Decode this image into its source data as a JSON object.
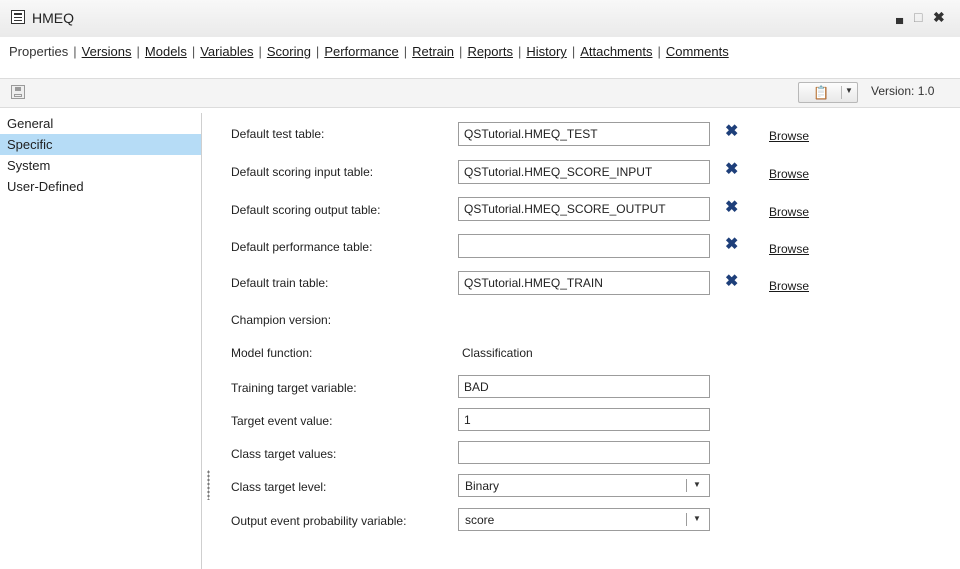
{
  "window": {
    "title": "HMEQ",
    "minimize": "▄",
    "restore": "□",
    "close": "✖"
  },
  "nav": {
    "items": [
      "Properties",
      "Versions",
      "Models",
      "Variables",
      "Scoring",
      "Performance",
      "Retrain",
      "Reports",
      "History",
      "Attachments",
      "Comments"
    ],
    "separator": "|"
  },
  "toolbar": {
    "version_label": "Version:",
    "version_value": "1.0"
  },
  "left_pane": {
    "items": [
      "General",
      "Specific",
      "System",
      "User-Defined"
    ],
    "selected": "Specific"
  },
  "form": {
    "browse_label": "Browse",
    "clear_icon": "✖",
    "rows": {
      "test_table": {
        "label": "Default test table:",
        "value": "QSTutorial.HMEQ_TEST"
      },
      "scoring_input": {
        "label": "Default scoring input table:",
        "value": "QSTutorial.HMEQ_SCORE_INPUT"
      },
      "scoring_output": {
        "label": "Default scoring output table:",
        "value": "QSTutorial.HMEQ_SCORE_OUTPUT"
      },
      "performance_table": {
        "label": "Default performance table:",
        "value": ""
      },
      "train_table": {
        "label": "Default train table:",
        "value": "QSTutorial.HMEQ_TRAIN"
      },
      "champion_version": {
        "label": "Champion version:",
        "value": ""
      },
      "model_function": {
        "label": "Model function:",
        "value": "Classification"
      },
      "training_target": {
        "label": "Training target variable:",
        "value": "BAD"
      },
      "target_event": {
        "label": "Target event value:",
        "value": "1"
      },
      "class_target_values": {
        "label": "Class target values:",
        "value": ""
      },
      "class_target_level": {
        "label": "Class target level:",
        "value": "Binary"
      },
      "output_event_prob": {
        "label": "Output event probability variable:",
        "value": "score"
      }
    }
  }
}
